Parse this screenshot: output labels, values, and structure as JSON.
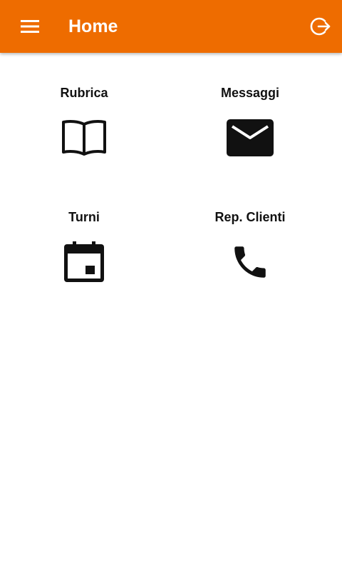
{
  "app_bar": {
    "title": "Home",
    "background_color": "#ee6c00",
    "menu_icon": "menu-icon",
    "logout_icon": "logout-icon"
  },
  "tiles": [
    {
      "label": "Rubrica",
      "icon": "book-icon"
    },
    {
      "label": "Messaggi",
      "icon": "mail-icon"
    },
    {
      "label": "Turni",
      "icon": "calendar-icon"
    },
    {
      "label": "Rep. Clienti",
      "icon": "phone-icon"
    }
  ]
}
